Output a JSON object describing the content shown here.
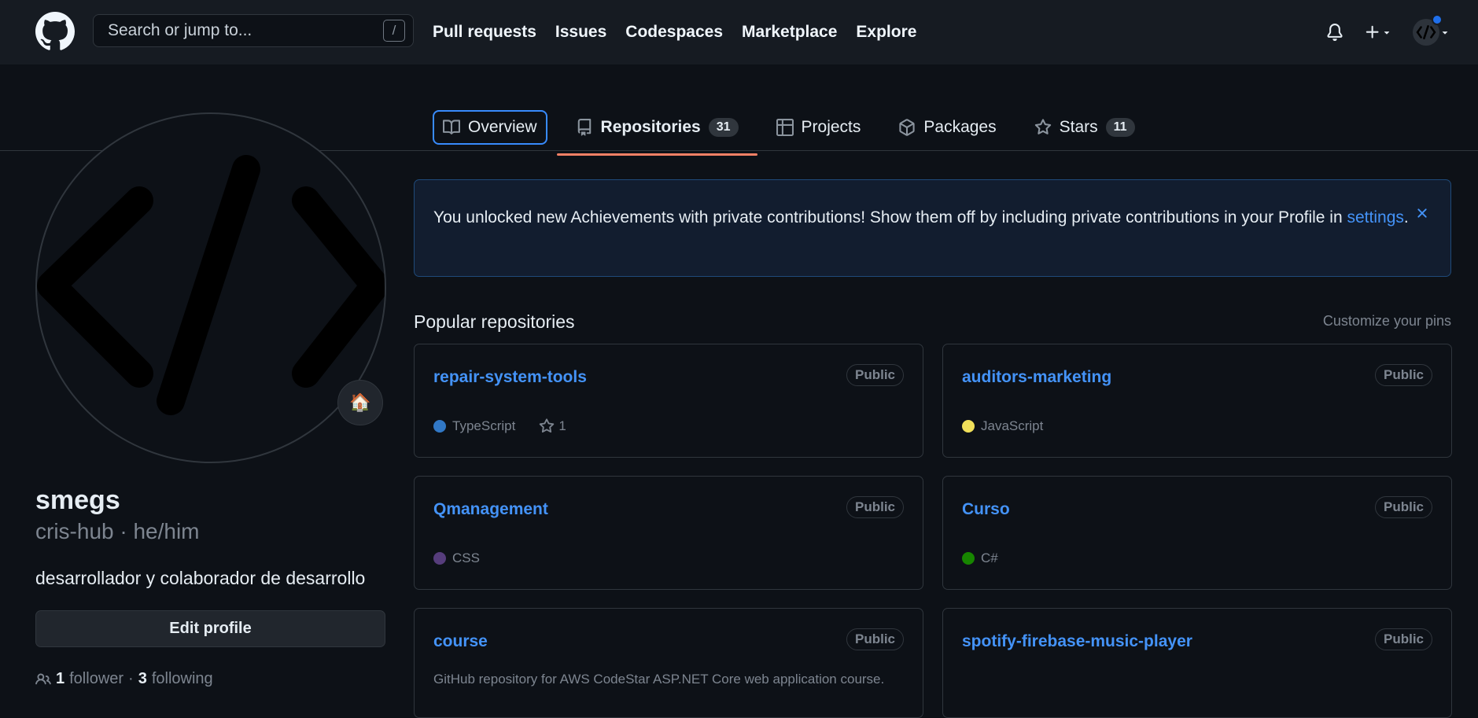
{
  "header": {
    "search_placeholder": "Search or jump to...",
    "search_shortcut": "/",
    "nav": [
      "Pull requests",
      "Issues",
      "Codespaces",
      "Marketplace",
      "Explore"
    ]
  },
  "tabs": [
    {
      "label": "Overview",
      "icon": "book-icon"
    },
    {
      "label": "Repositories",
      "icon": "repo-icon",
      "count": "31",
      "active": true
    },
    {
      "label": "Projects",
      "icon": "table-icon"
    },
    {
      "label": "Packages",
      "icon": "package-icon"
    },
    {
      "label": "Stars",
      "icon": "star-icon",
      "count": "11"
    }
  ],
  "profile": {
    "status_emoji": "🏠",
    "name": "smegs",
    "login": "cris-hub · he/him",
    "bio": "desarrollador y colaborador de desarrollo",
    "edit_label": "Edit profile",
    "followers_count": "1",
    "followers_label": "follower",
    "sep": "·",
    "following_count": "3",
    "following_label": "following"
  },
  "banner": {
    "text": "You unlocked new Achievements with private contributions! Show them off by including private contributions in your Profile in",
    "link": "settings",
    "period": "."
  },
  "popular": {
    "title": "Popular repositories",
    "customize": "Customize your pins",
    "repos": [
      {
        "name": "repair-system-tools",
        "visibility": "Public",
        "language": "TypeScript",
        "lang_color": "#3178c6",
        "stars": "1"
      },
      {
        "name": "auditors-marketing",
        "visibility": "Public",
        "language": "JavaScript",
        "lang_color": "#f1e05a"
      },
      {
        "name": "Qmanagement",
        "visibility": "Public",
        "language": "CSS",
        "lang_color": "#563d7c"
      },
      {
        "name": "Curso",
        "visibility": "Public",
        "language": "C#",
        "lang_color": "#178600"
      },
      {
        "name": "course",
        "visibility": "Public",
        "description": "GitHub repository for AWS CodeStar ASP.NET Core web application course."
      },
      {
        "name": "spotify-firebase-music-player",
        "visibility": "Public"
      }
    ]
  }
}
